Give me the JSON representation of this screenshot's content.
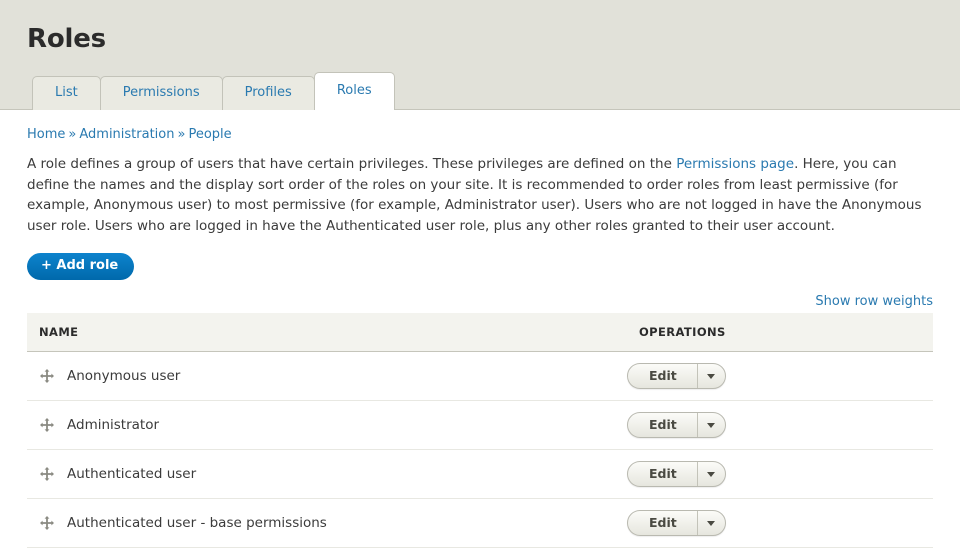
{
  "header": {
    "title": "Roles"
  },
  "tabs": [
    {
      "label": "List",
      "active": false
    },
    {
      "label": "Permissions",
      "active": false
    },
    {
      "label": "Profiles",
      "active": false
    },
    {
      "label": "Roles",
      "active": true
    }
  ],
  "breadcrumb": {
    "items": [
      "Home",
      "Administration",
      "People"
    ],
    "separator": "»"
  },
  "intro": {
    "part1": "A role defines a group of users that have certain privileges. These privileges are defined on the ",
    "link": "Permissions page",
    "part2": ". Here, you can define the names and the display sort order of the roles on your site. It is recommended to order roles from least permissive (for example, Anonymous user) to most permissive (for example, Administrator user). Users who are not logged in have the Anonymous user role. Users who are logged in have the Authenticated user role, plus any other roles granted to their user account."
  },
  "actions": {
    "add_role_label": "+ Add role",
    "show_row_weights_label": "Show row weights"
  },
  "table": {
    "columns": [
      "NAME",
      "OPERATIONS"
    ],
    "rows": [
      {
        "name": "Anonymous user",
        "operation_label": "Edit"
      },
      {
        "name": "Administrator",
        "operation_label": "Edit"
      },
      {
        "name": "Authenticated user",
        "operation_label": "Edit"
      },
      {
        "name": "Authenticated user - base permissions",
        "operation_label": "Edit"
      }
    ]
  },
  "colors": {
    "header_band": "#e1e1d9",
    "link": "#2a7ab0",
    "primary_button": "#0071b8",
    "table_header_bg": "#f3f3ee",
    "text": "#3b3b3b"
  }
}
